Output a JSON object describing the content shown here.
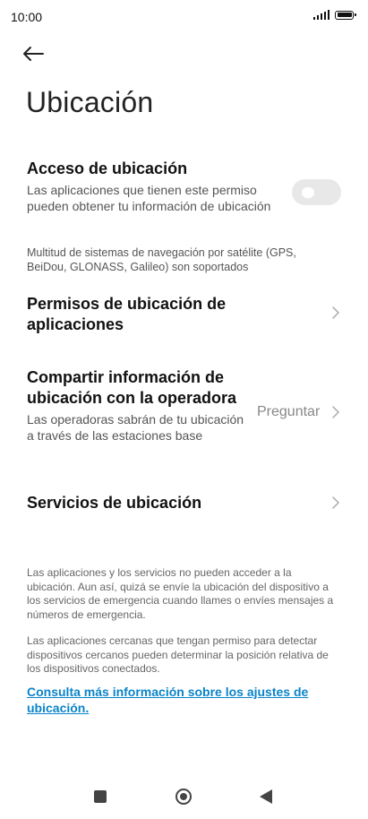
{
  "status_bar": {
    "time": "10:00"
  },
  "header": {
    "title": "Ubicación",
    "back_icon": "arrow-left-icon"
  },
  "location_access": {
    "title": "Acceso de ubicación",
    "description": "Las aplicaciones que tienen este permiso pueden obtener tu información de ubicación",
    "enabled": false
  },
  "gnss_note": "Multitud de sistemas de navegación por satélite (GPS, BeiDou, GLONASS, Galileo) son soportados",
  "app_permissions": {
    "title": "Permisos de ubicación de aplicaciones"
  },
  "carrier_sharing": {
    "title": "Compartir información de ubicación con la operadora",
    "description": "Las operadoras sabrán de tu ubicación a través de las estaciones base",
    "value": "Preguntar"
  },
  "location_services": {
    "title": "Servicios de ubicación"
  },
  "footer_notes": [
    "Las aplicaciones y los servicios no pueden acceder a la ubicación. Aun así, quizá se envíe la ubicación del dispositivo a los servicios de emergencia cuando llames o envíes mensajes a números de emergencia.",
    "Las aplicaciones cercanas que tengan permiso para detectar dispositivos cercanos pueden determinar la posición relativa de los dispositivos conectados."
  ],
  "link_text": "Consulta más información sobre los ajustes de ubicación.",
  "colors": {
    "link": "#0a84c9",
    "toggle_off": "#e8e8e8"
  }
}
